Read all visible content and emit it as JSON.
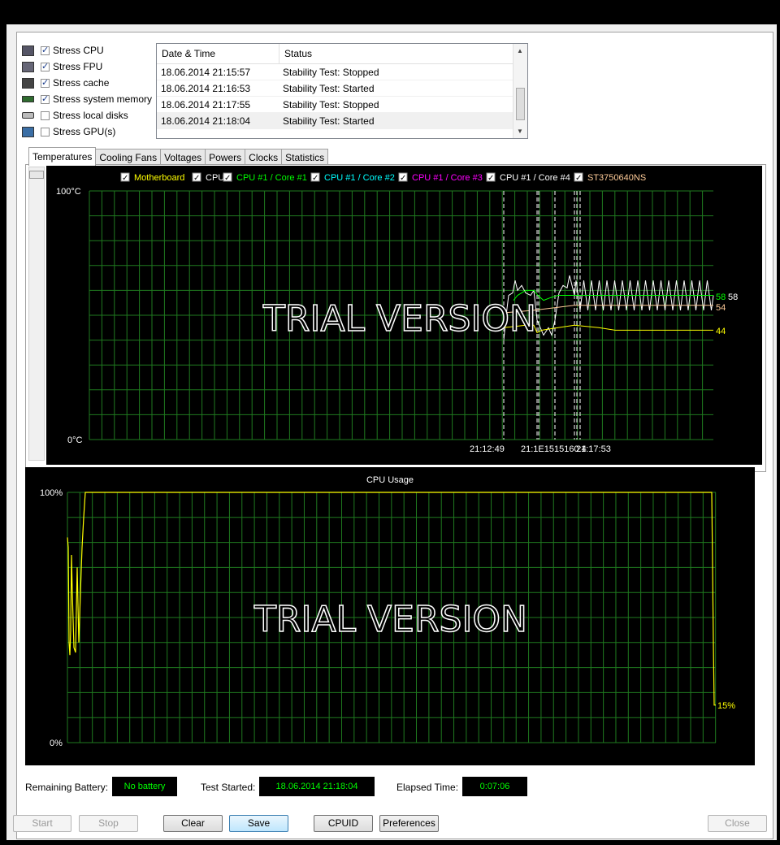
{
  "stress_options": [
    {
      "label": "Stress CPU",
      "checked": true,
      "icon": "cpu-icon"
    },
    {
      "label": "Stress FPU",
      "checked": true,
      "icon": "fpu-icon"
    },
    {
      "label": "Stress cache",
      "checked": true,
      "icon": "cache-icon"
    },
    {
      "label": "Stress system memory",
      "checked": true,
      "icon": "memory-icon"
    },
    {
      "label": "Stress local disks",
      "checked": false,
      "icon": "disk-icon"
    },
    {
      "label": "Stress GPU(s)",
      "checked": false,
      "icon": "gpu-icon"
    }
  ],
  "log": {
    "headers": [
      "Date & Time",
      "Status"
    ],
    "rows": [
      {
        "time": "18.06.2014 21:15:57",
        "status": "Stability Test: Stopped"
      },
      {
        "time": "18.06.2014 21:16:53",
        "status": "Stability Test: Started"
      },
      {
        "time": "18.06.2014 21:17:55",
        "status": "Stability Test: Stopped"
      },
      {
        "time": "18.06.2014 21:18:04",
        "status": "Stability Test: Started"
      }
    ]
  },
  "tabs": [
    "Temperatures",
    "Cooling Fans",
    "Voltages",
    "Powers",
    "Clocks",
    "Statistics"
  ],
  "active_tab": "Temperatures",
  "watermark": "TRIAL VERSION",
  "chart_data": [
    {
      "type": "line",
      "legend": [
        {
          "name": "Motherboard",
          "color": "#ffff00"
        },
        {
          "name": "CPU",
          "color": "#ffffff"
        },
        {
          "name": "CPU #1 / Core #1",
          "color": "#00ff00"
        },
        {
          "name": "CPU #1 / Core #2",
          "color": "#00ffff"
        },
        {
          "name": "CPU #1 / Core #3",
          "color": "#ff00ff"
        },
        {
          "name": "CPU #1 / Core #4",
          "color": "#ffffff"
        },
        {
          "name": "ST3750640NS",
          "color": "#ffcc99"
        }
      ],
      "y_top_label": "100°C",
      "y_bottom_label": "0°C",
      "ylim": [
        0,
        100
      ],
      "grid": true,
      "time_labels": [
        "21:12:49",
        "21:15:57",
        "21:16:53",
        "21:17:53"
      ],
      "overlap_time_label": "21:1E1515160:4",
      "current_values": [
        {
          "label": "58",
          "color": "#00ff00"
        },
        {
          "label": "58",
          "color": "#ffffff"
        },
        {
          "label": "54",
          "color": "#ffcc99"
        },
        {
          "label": "44",
          "color": "#ffff00"
        }
      ]
    },
    {
      "type": "line",
      "title": "CPU Usage",
      "y_top_label": "100%",
      "y_bottom_label": "0%",
      "ylim": [
        0,
        100
      ],
      "grid": true,
      "current_value": "15%",
      "line_color": "#ffff00"
    }
  ],
  "status": {
    "battery_label": "Remaining Battery:",
    "battery_value": "No battery",
    "started_label": "Test Started:",
    "started_value": "18.06.2014 21:18:04",
    "elapsed_label": "Elapsed Time:",
    "elapsed_value": "0:07:06"
  },
  "buttons": {
    "start": "Start",
    "stop": "Stop",
    "clear": "Clear",
    "save": "Save",
    "cpuid": "CPUID",
    "preferences": "Preferences",
    "close": "Close"
  }
}
